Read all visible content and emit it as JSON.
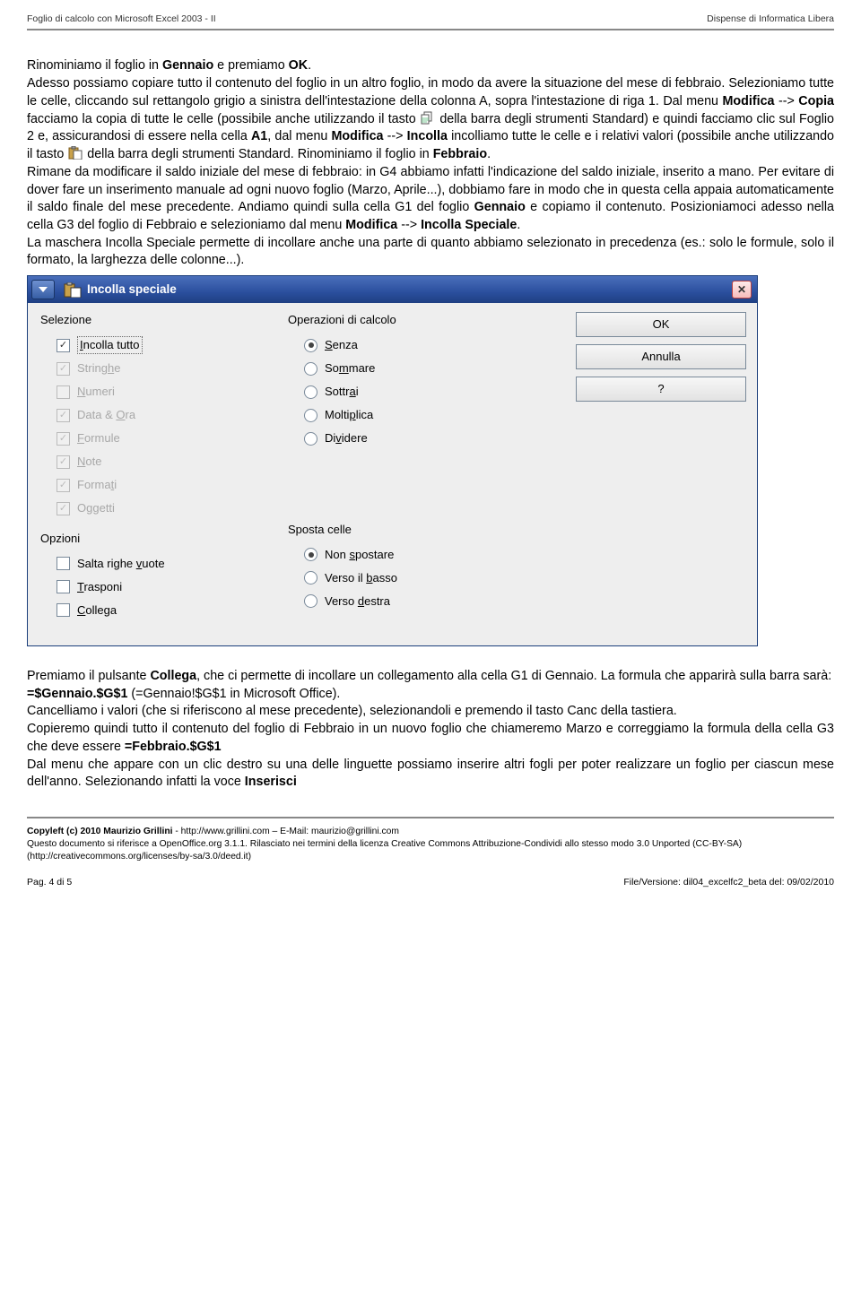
{
  "header": {
    "left": "Foglio di calcolo con Microsoft Excel 2003 - II",
    "right": "Dispense di Informatica Libera"
  },
  "para1_a": "Rinominiamo il foglio in ",
  "para1_b": "Gennaio",
  "para1_c": " e premiamo ",
  "para1_d": "OK",
  "para1_e": ".",
  "para2_a": "Adesso possiamo copiare tutto il contenuto del foglio in un altro foglio, in modo da avere la situazione del mese di febbraio. Selezioniamo tutte le celle, cliccando sul rettangolo grigio a sinistra dell'intestazione della colonna A, sopra l'intestazione di riga 1. Dal menu ",
  "para2_b": "Modifica",
  "para2_c": " --> ",
  "para2_d": "Copia",
  "para2_e": " facciamo la copia di tutte le celle (possibile anche utilizzando il tasto ",
  "para2_f": " della barra degli strumenti Standard) e quindi facciamo clic sul Foglio 2 e, assicurandosi di essere nella cella ",
  "para2_g": "A1",
  "para2_h": ", dal menu ",
  "para2_i": "Modifica",
  "para2_j": " --> ",
  "para2_k": "Incolla",
  "para2_l": " incolliamo tutte le celle e i relativi valori (possibile anche utilizzando il tasto ",
  "para2_m": " della barra degli strumenti Standard. Rinominiamo il foglio in ",
  "para2_n": "Febbraio",
  "para2_o": ".",
  "para3": "Rimane da modificare il saldo iniziale del mese di febbraio: in G4 abbiamo infatti l'indicazione del saldo iniziale, inserito a mano. Per evitare di dover fare un inserimento manuale ad ogni nuovo foglio (Marzo, Aprile...), dobbiamo fare in modo che in questa cella appaia automaticamente il saldo finale del mese precedente. Andiamo quindi sulla cella G1 del foglio ",
  "para3_b": "Gennaio",
  "para3_c": " e copiamo il contenuto. Posizioniamoci adesso nella cella G3 del foglio di Febbraio e selezioniamo dal menu ",
  "para3_d": "Modifica",
  "para3_e": " --> ",
  "para3_f": "Incolla Speciale",
  "para3_g": ".",
  "para4": "La maschera Incolla Speciale permette di incollare anche una parte di quanto abbiamo selezionato in precedenza (es.: solo le formule, solo il formato, la larghezza delle colonne...).",
  "dialog": {
    "title": "Incolla speciale",
    "selezione": {
      "title": "Selezione",
      "items": [
        {
          "label": "Incolla tutto",
          "checked": true,
          "disabled": false,
          "accel": "I",
          "dotted": true
        },
        {
          "label": "Stringhe",
          "checked": true,
          "disabled": true,
          "accel": "h"
        },
        {
          "label": "Numeri",
          "checked": false,
          "disabled": true,
          "accel": "N"
        },
        {
          "label": "Data & Ora",
          "checked": true,
          "disabled": true,
          "accel": "O"
        },
        {
          "label": "Formule",
          "checked": true,
          "disabled": true,
          "accel": "F"
        },
        {
          "label": "Note",
          "checked": true,
          "disabled": true,
          "accel": "N"
        },
        {
          "label": "Formati",
          "checked": true,
          "disabled": true,
          "accel": "t"
        },
        {
          "label": "Oggetti",
          "checked": true,
          "disabled": true,
          "accel": "g"
        }
      ]
    },
    "opzioni": {
      "title": "Opzioni",
      "items": [
        {
          "label": "Salta righe vuote",
          "checked": false,
          "accel": "v"
        },
        {
          "label": "Trasponi",
          "checked": false,
          "accel": "T"
        },
        {
          "label": "Collega",
          "checked": false,
          "accel": "C"
        }
      ]
    },
    "calcolo": {
      "title": "Operazioni di calcolo",
      "items": [
        {
          "label": "Senza",
          "selected": true,
          "accel": "S"
        },
        {
          "label": "Sommare",
          "selected": false,
          "accel": "m"
        },
        {
          "label": "Sottrai",
          "selected": false,
          "accel": "a"
        },
        {
          "label": "Moltiplica",
          "selected": false,
          "accel": "p"
        },
        {
          "label": "Dividere",
          "selected": false,
          "accel": "v"
        }
      ]
    },
    "sposta": {
      "title": "Sposta celle",
      "items": [
        {
          "label": "Non spostare",
          "selected": true,
          "accel": "s"
        },
        {
          "label": "Verso il basso",
          "selected": false,
          "accel": "b"
        },
        {
          "label": "Verso destra",
          "selected": false,
          "accel": "d"
        }
      ]
    },
    "buttons": {
      "ok": "OK",
      "cancel": "Annulla",
      "help": "?"
    }
  },
  "after1_a": "Premiamo il pulsante ",
  "after1_b": "Collega",
  "after1_c": ", che ci permette di incollare un collegamento alla cella G1 di Gennaio. La formula che apparirà sulla barra sarà:",
  "after2_a": "=$Gennaio.$G$1",
  "after2_b": " (=Gennaio!$G$1 in Microsoft Office).",
  "after3": "Cancelliamo i valori (che si riferiscono al mese precedente), selezionandoli e premendo il tasto Canc della tastiera.",
  "after4_a": "Copieremo quindi tutto il contenuto del foglio di Febbraio in un nuovo foglio che chiameremo Marzo e correggiamo la formula della cella G3 che deve essere ",
  "after4_b": "=Febbraio.$G$1",
  "after5_a": "Dal menu che appare con un clic destro su una delle linguette possiamo inserire altri fogli per poter realizzare un foglio per ciascun mese dell'anno. Selezionando infatti la voce ",
  "after5_b": "Inserisci",
  "footer": {
    "line1_a": "Copyleft (c) 2010 Maurizio Grillini",
    "line1_b": " - http://www.grillini.com – E-Mail: maurizio@grillini.com",
    "line2": "Questo documento si riferisce a OpenOffice.org 3.1.1. Rilasciato nei termini della licenza Creative Commons Attribuzione-Condividi allo stesso modo 3.0 Unported (CC-BY-SA) (http://creativecommons.org/licenses/by-sa/3.0/deed.it)",
    "page": "Pag. 4 di 5",
    "version": "File/Versione: dil04_excelfc2_beta del: 09/02/2010"
  }
}
